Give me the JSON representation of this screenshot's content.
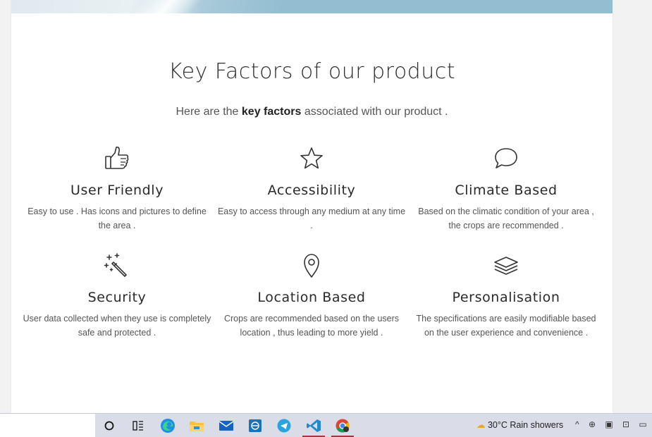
{
  "section": {
    "title": "Key Factors of our product",
    "subtitle_pre": "Here are the ",
    "subtitle_bold": "key factors",
    "subtitle_post": " associated with our product ."
  },
  "features": [
    {
      "icon": "thumbs-up-icon",
      "name": "User Friendly",
      "desc": "Easy to use . Has icons and pictures to define the area ."
    },
    {
      "icon": "star-icon",
      "name": "Accessibility",
      "desc": "Easy to access through any medium at any time ."
    },
    {
      "icon": "chat-bubble-icon",
      "name": "Climate Based",
      "desc": "Based on the climatic condition of your area , the crops are recommended ."
    },
    {
      "icon": "magic-wand-icon",
      "name": "Security",
      "desc": "User data collected when they use is completely safe and protected ."
    },
    {
      "icon": "location-pin-icon",
      "name": "Location Based",
      "desc": "Crops are recommended based on the users location , thus leading to more yield ."
    },
    {
      "icon": "layers-icon",
      "name": "Personalisation",
      "desc": "The specifications are easily modifiable based on the user experience and convenience ."
    }
  ],
  "taskbar": {
    "apps": [
      "cortana-icon",
      "task-view-icon",
      "edge-icon",
      "file-explorer-icon",
      "mail-icon",
      "app-icon",
      "telegram-icon",
      "vscode-icon",
      "chrome-icon"
    ],
    "weather_text": "30°C  Rain showers",
    "tray_glyphs": "^ ⊕ ▣ ⊡ ▭"
  },
  "colors": {
    "banner": "#93bed2",
    "active_indicator": "#a23b3b"
  }
}
